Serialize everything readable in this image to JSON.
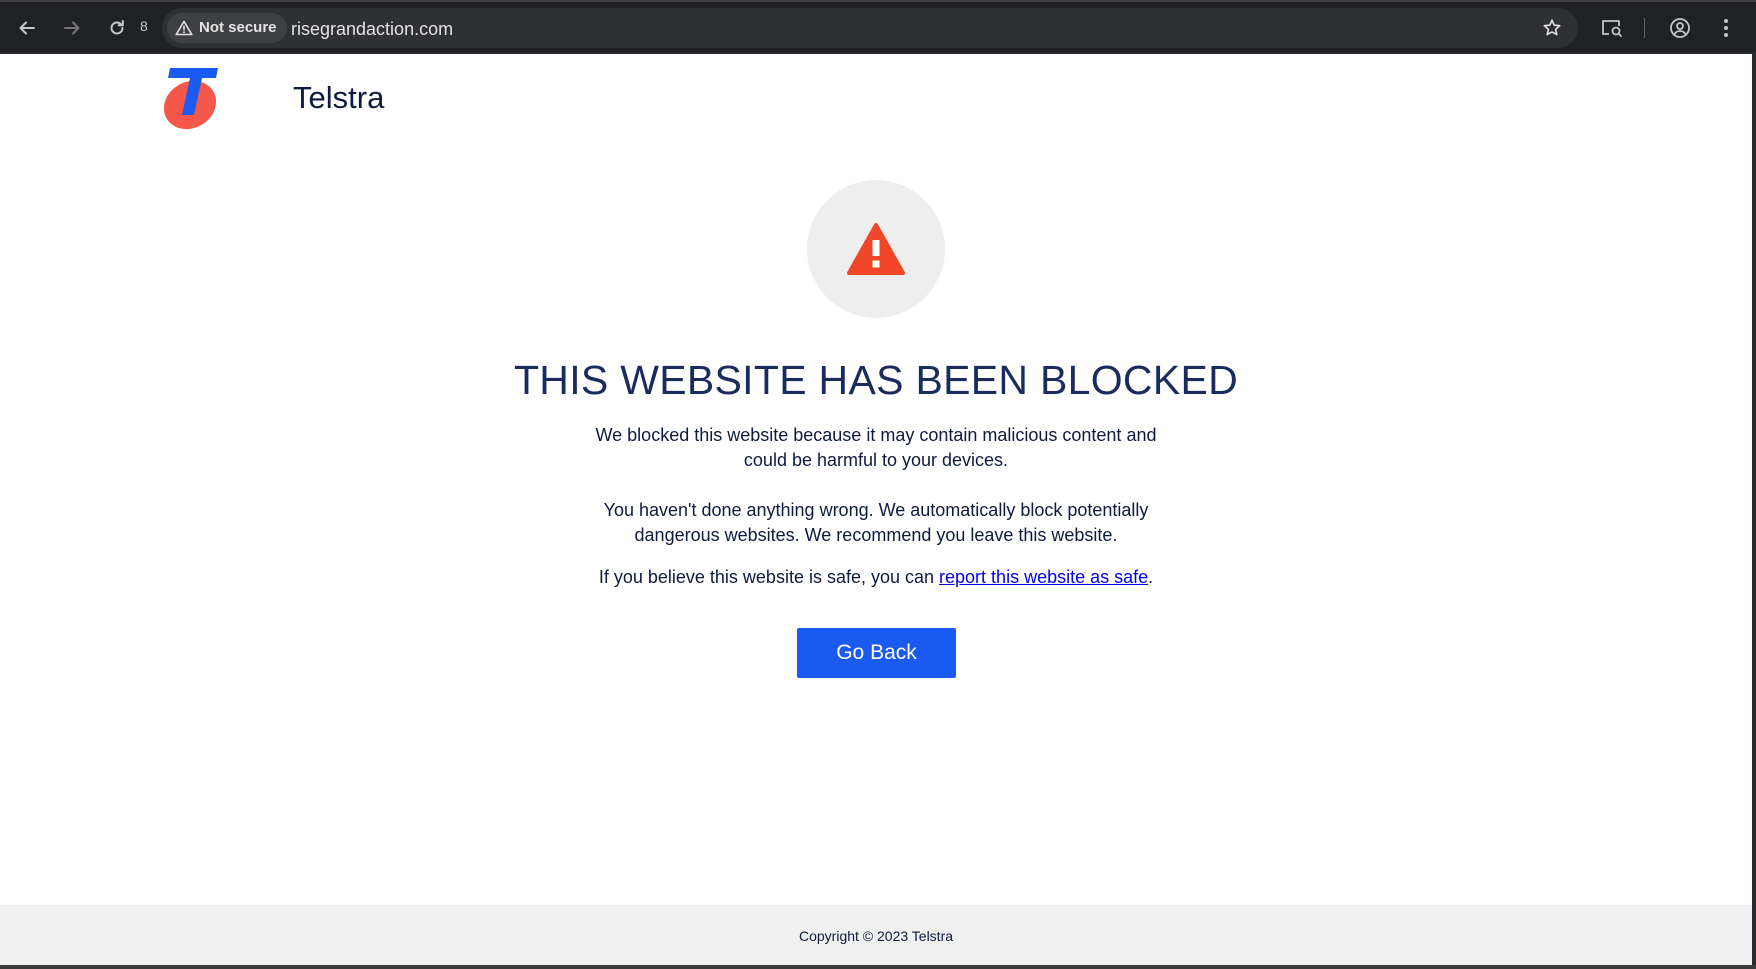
{
  "browser": {
    "reload_count": "8",
    "security_label": "Not secure",
    "url": "risegrandaction.com",
    "icons": {
      "back": "arrow-left-icon",
      "forward": "arrow-right-icon",
      "reload": "reload-icon",
      "warning": "warning-triangle-icon",
      "bookmark": "star-icon",
      "lens": "search-page-icon",
      "profile": "account-icon",
      "menu": "kebab-menu-icon"
    }
  },
  "header": {
    "brand_name": "Telstra",
    "logo_colors": {
      "letter": "#1a5af0",
      "ellipse": "#f5584a"
    }
  },
  "main": {
    "alert_icon": "warning-triangle-icon",
    "alert_color": "#f0472a",
    "headline": "THIS WEBSITE HAS BEEN BLOCKED",
    "paragraph_1": "We blocked this website because it may contain malicious content and could be harmful to your devices.",
    "paragraph_2": "You haven't done anything wrong. We automatically block potentially dangerous websites. We recommend you leave this website.",
    "report_prefix": "If you believe this website is safe, you can ",
    "report_link": "report this website as safe",
    "report_suffix": ".",
    "go_back_label": "Go Back",
    "button_color": "#1a5af0"
  },
  "footer": {
    "copyright": "Copyright © 2023 Telstra"
  }
}
